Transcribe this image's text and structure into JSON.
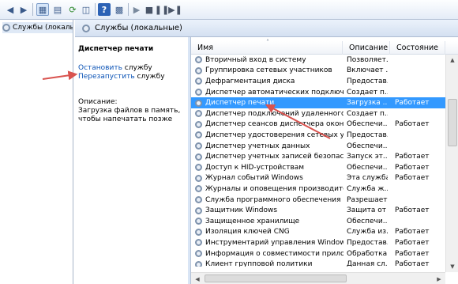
{
  "toolbar": {
    "icons": [
      "back-arrow-icon",
      "forward-arrow-icon",
      "console-tree-icon",
      "properties-icon",
      "refresh-icon",
      "export-icon",
      "help-icon",
      "view-icon",
      "start-icon",
      "stop-icon",
      "pause-icon",
      "restart-icon"
    ]
  },
  "tree": {
    "label": "Службы (локалы"
  },
  "header": {
    "title": "Службы (локальные)"
  },
  "left_panel": {
    "title": "Диспетчер печати",
    "stop_link": "Остановить",
    "stop_suffix": " службу",
    "restart_link": "Перезапустить",
    "restart_suffix": " службу",
    "description_label": "Описание:",
    "description_text": "Загрузка файлов в память, чтобы напечатать позже"
  },
  "columns": {
    "name": "Имя",
    "description": "Описание",
    "state": "Состояние"
  },
  "rows": [
    {
      "name": "Вторичный вход в систему",
      "desc": "Позволяет...",
      "state": ""
    },
    {
      "name": "Группировка сетевых участников",
      "desc": "Включает ...",
      "state": ""
    },
    {
      "name": "Дефрагментация диска",
      "desc": "Предостав...",
      "state": ""
    },
    {
      "name": "Диспетчер автоматических подключений ...",
      "desc": "Создает п...",
      "state": ""
    },
    {
      "name": "Диспетчер печати",
      "desc": "Загрузка ...",
      "state": "Работает",
      "selected": true
    },
    {
      "name": "Диспетчер подключений удаленного дост...",
      "desc": "Создает п...",
      "state": ""
    },
    {
      "name": "Диспетчер сеансов диспетчера окон рабо...",
      "desc": "Обеспечи...",
      "state": "Работает"
    },
    {
      "name": "Диспетчер удостоверения сетевых участ...",
      "desc": "Предостав...",
      "state": ""
    },
    {
      "name": "Диспетчер учетных данных",
      "desc": "Обеспечи...",
      "state": ""
    },
    {
      "name": "Диспетчер учетных записей безопасности",
      "desc": "Запуск эт...",
      "state": "Работает"
    },
    {
      "name": "Доступ к HID-устройствам",
      "desc": "Обеспечи...",
      "state": "Работает"
    },
    {
      "name": "Журнал событий Windows",
      "desc": "Эта служба...",
      "state": "Работает"
    },
    {
      "name": "Журналы и оповещения производительн...",
      "desc": "Служба ж...",
      "state": ""
    },
    {
      "name": "Служба программного обеспечения",
      "desc": "Разрешает...",
      "state": ""
    },
    {
      "name": "Защитник Windows",
      "desc": "Защита от ...",
      "state": "Работает"
    },
    {
      "name": "Защищенное хранилище",
      "desc": "Обеспечи...",
      "state": ""
    },
    {
      "name": "Изоляция ключей CNG",
      "desc": "Служба из...",
      "state": "Работает"
    },
    {
      "name": "Инструментарий управления Windows",
      "desc": "Предостав...",
      "state": "Работает"
    },
    {
      "name": "Информация о совместимости приложе...",
      "desc": "Обработка...",
      "state": "Работает"
    },
    {
      "name": "Клиент групповой политики",
      "desc": "Данная сл...",
      "state": "Работает"
    }
  ],
  "colors": {
    "selection": "#3399ff",
    "link": "#0b53b6",
    "arrow": "#d9534f"
  }
}
